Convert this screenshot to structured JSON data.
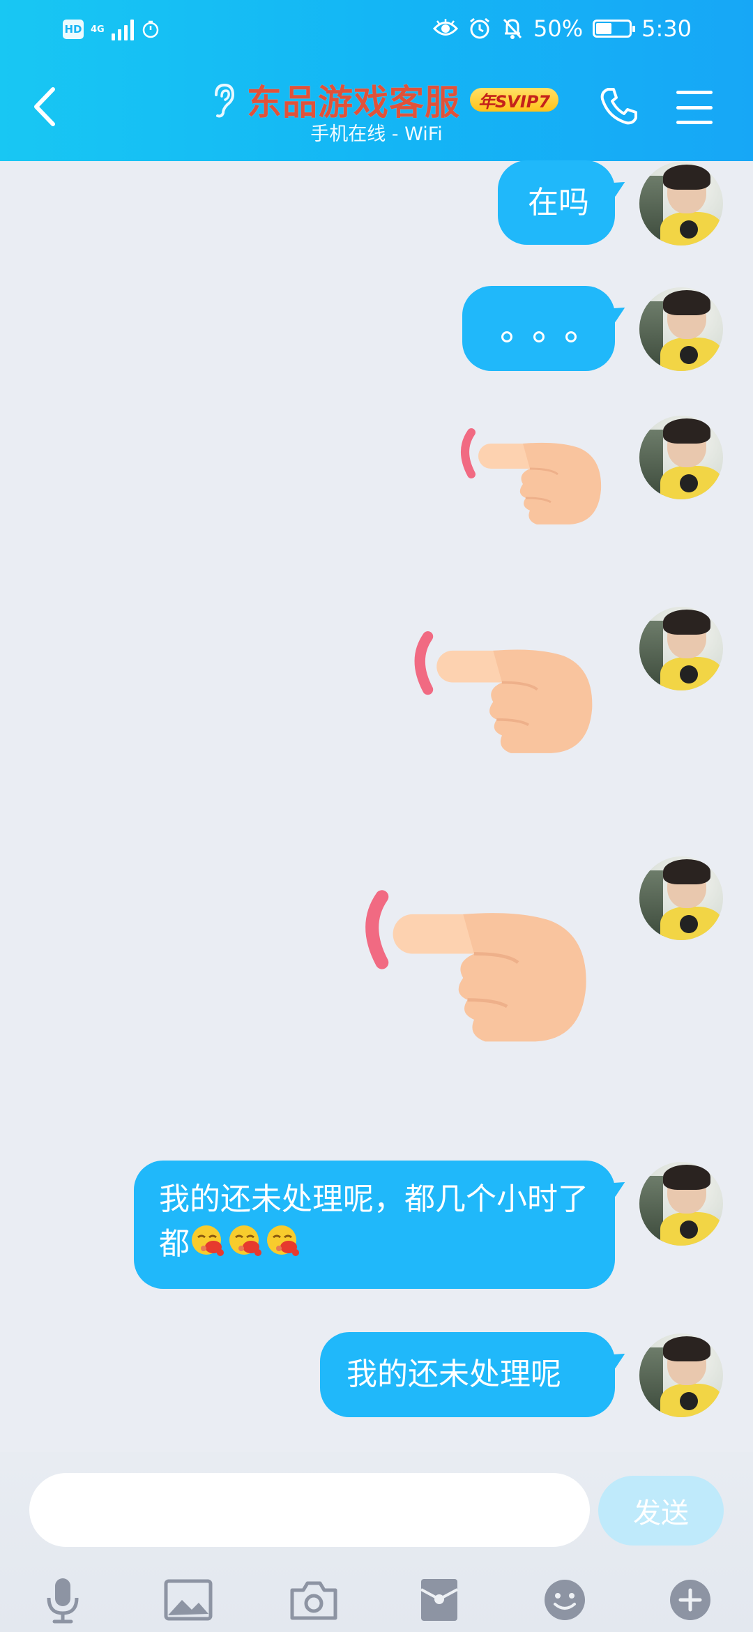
{
  "status_bar": {
    "hd": "HD",
    "network": "4G",
    "battery_percent": "50%",
    "time": "5:30",
    "icons": [
      "eye-icon",
      "alarm-icon",
      "mute-bell-icon",
      "battery-icon"
    ]
  },
  "header": {
    "title": "东品游戏客服",
    "vip_badge": "年SVIP7",
    "subtitle": "手机在线 - WiFi",
    "colors": {
      "gradient_start": "#18c7f3",
      "gradient_end": "#17a7f6",
      "title": "#e0523a"
    }
  },
  "messages": [
    {
      "type": "text",
      "text": "在吗"
    },
    {
      "type": "text",
      "text": "。。。"
    },
    {
      "type": "sticker",
      "name": "pointing-finger-small"
    },
    {
      "type": "sticker",
      "name": "pointing-finger-medium"
    },
    {
      "type": "sticker",
      "name": "pointing-finger-large"
    },
    {
      "type": "text",
      "text": "我的还未处理呢，都几个小时了都",
      "emoji_count": 3
    },
    {
      "type": "text",
      "text": "我的还未处理呢"
    }
  ],
  "input": {
    "value": "",
    "send_label": "发送"
  },
  "toolbar_icons": [
    "mic-icon",
    "image-icon",
    "camera-icon",
    "red-packet-icon",
    "emoji-icon",
    "plus-icon"
  ],
  "colors": {
    "bubble": "#20b8fa",
    "background": "#eaedf3",
    "send_button": "#bfeafb"
  }
}
